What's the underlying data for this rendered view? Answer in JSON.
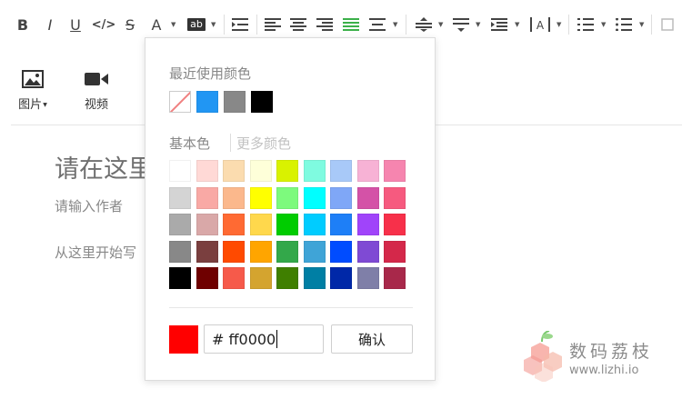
{
  "toolbar": {
    "buttons": [
      {
        "name": "bold",
        "glyph": "B"
      },
      {
        "name": "italic",
        "glyph": "I"
      },
      {
        "name": "underline",
        "glyph": "U"
      },
      {
        "name": "code",
        "glyph": "</>"
      },
      {
        "name": "strikethrough",
        "glyph": "S"
      },
      {
        "name": "font-color",
        "glyph": "A"
      },
      {
        "name": "background-color",
        "glyph": "ab"
      }
    ],
    "active_color": "#3cb04a"
  },
  "insert": {
    "image_label": "图片",
    "video_label": "视频"
  },
  "editor": {
    "title_placeholder": "请在这里",
    "author_placeholder": "请输入作者",
    "body_placeholder": "从这里开始写"
  },
  "color_picker": {
    "recent_title": "最近使用颜色",
    "recent_colors": [
      "none",
      "#2196f3",
      "#888888",
      "#000000"
    ],
    "basic_title": "基本色",
    "more_title": "更多颜色",
    "basic_colors": [
      [
        "#ffffff",
        "#ffd9d6",
        "#fbdcaf",
        "#feffd9",
        "#d9f200",
        "#7ffbe0",
        "#a8c9f8",
        "#f7b2d5",
        "#f685af"
      ],
      [
        "#d4d4d4",
        "#f9a9a5",
        "#fbb88c",
        "#ffff00",
        "#7dfa7d",
        "#00ffff",
        "#7fa7f7",
        "#d452a7",
        "#f65a7f"
      ],
      [
        "#aaaaaa",
        "#d9a8a8",
        "#ff6a33",
        "#ffd84c",
        "#00cc00",
        "#00ccff",
        "#1e7ff7",
        "#a044fa",
        "#f7304a"
      ],
      [
        "#888888",
        "#7a3f3f",
        "#ff4a00",
        "#ffa500",
        "#33a84a",
        "#3fa4d7",
        "#004cff",
        "#7f4ad4",
        "#d4284a"
      ],
      [
        "#000000",
        "#6f0000",
        "#f65a4a",
        "#d4a42f",
        "#3f7f00",
        "#007fa4",
        "#0028a8",
        "#7f7fa8",
        "#a8284a"
      ]
    ],
    "preview_color": "#ff0000",
    "hex_value": "# ff0000",
    "confirm_label": "确认"
  },
  "watermark": {
    "line1": "数码荔枝",
    "line2": "www.lizhi.io"
  }
}
